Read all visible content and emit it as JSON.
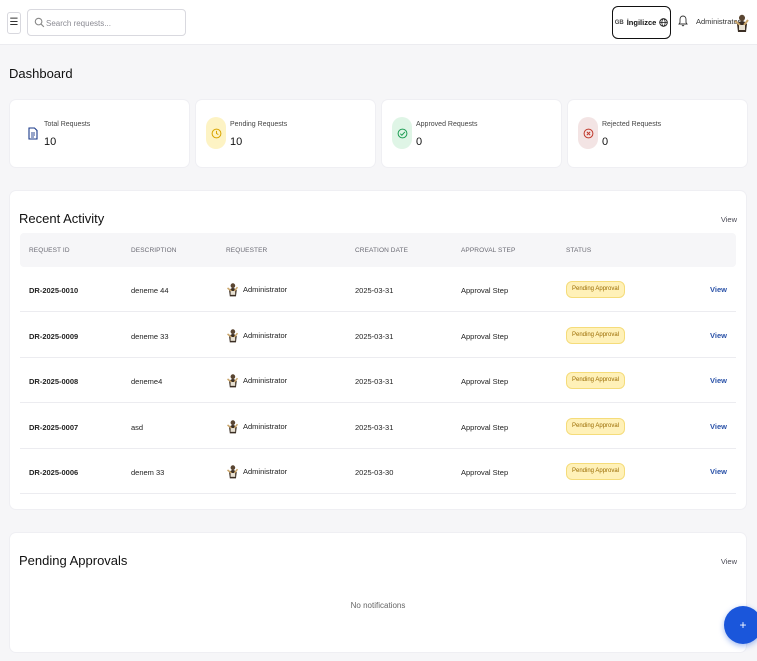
{
  "header": {
    "search_placeholder": "Search requests...",
    "lang_code": "GB",
    "lang_label": "İngilizce",
    "user_name": "Administrator"
  },
  "page": {
    "title": "Dashboard"
  },
  "stats": [
    {
      "label": "Total Requests",
      "value": "10",
      "icon": "document-icon",
      "color": "#1a3a8a"
    },
    {
      "label": "Pending Requests",
      "value": "10",
      "icon": "clock-icon",
      "color": "#d9a400"
    },
    {
      "label": "Approved Requests",
      "value": "0",
      "icon": "check-circle-icon",
      "color": "#1f9d55"
    },
    {
      "label": "Rejected Requests",
      "value": "0",
      "icon": "x-circle-icon",
      "color": "#c0392b"
    }
  ],
  "recent": {
    "title": "Recent Activity",
    "view_label": "View",
    "columns": [
      "REQUEST ID",
      "DESCRIPTION",
      "REQUESTER",
      "CREATION DATE",
      "APPROVAL STEP",
      "STATUS"
    ],
    "rows": [
      {
        "id": "DR-2025-0010",
        "description": "deneme 44",
        "requester": "Administrator",
        "date": "2025-03-31",
        "step": "Approval Step",
        "status": "Pending Approval",
        "action": "View"
      },
      {
        "id": "DR-2025-0009",
        "description": "deneme 33",
        "requester": "Administrator",
        "date": "2025-03-31",
        "step": "Approval Step",
        "status": "Pending Approval",
        "action": "View"
      },
      {
        "id": "DR-2025-0008",
        "description": "deneme4",
        "requester": "Administrator",
        "date": "2025-03-31",
        "step": "Approval Step",
        "status": "Pending Approval",
        "action": "View"
      },
      {
        "id": "DR-2025-0007",
        "description": "asd",
        "requester": "Administrator",
        "date": "2025-03-31",
        "step": "Approval Step",
        "status": "Pending Approval",
        "action": "View"
      },
      {
        "id": "DR-2025-0006",
        "description": "denem 33",
        "requester": "Administrator",
        "date": "2025-03-30",
        "step": "Approval Step",
        "status": "Pending Approval",
        "action": "View"
      }
    ]
  },
  "pending": {
    "title": "Pending Approvals",
    "view_label": "View",
    "empty_text": "No notifications"
  },
  "fab": {
    "label": "+"
  }
}
